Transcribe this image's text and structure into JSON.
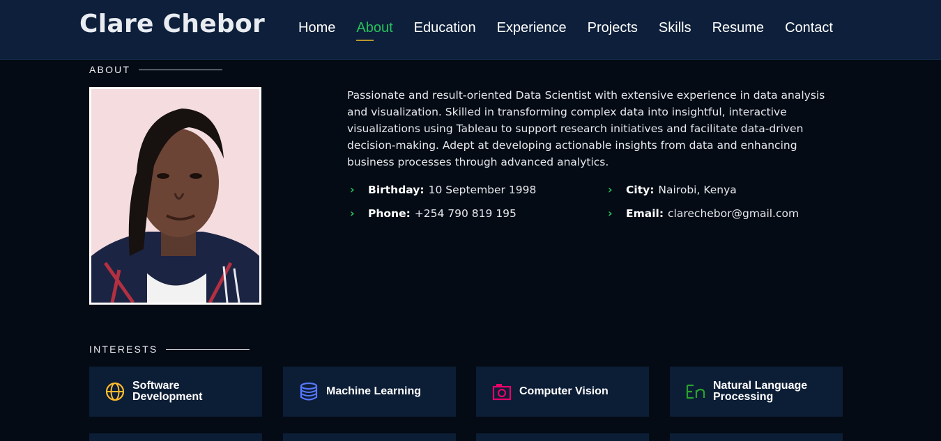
{
  "header": {
    "logo": "Clare Chebor",
    "nav": [
      {
        "label": "Home",
        "active": false
      },
      {
        "label": "About",
        "active": true
      },
      {
        "label": "Education",
        "active": false
      },
      {
        "label": "Experience",
        "active": false
      },
      {
        "label": "Projects",
        "active": false
      },
      {
        "label": "Skills",
        "active": false
      },
      {
        "label": "Resume",
        "active": false
      },
      {
        "label": "Contact",
        "active": false
      }
    ]
  },
  "about": {
    "section_title": "ABOUT",
    "description": "Passionate and result-oriented Data Scientist with extensive experience in data analysis and visualization. Skilled in transforming complex data into insightful, interactive visualizations using Tableau to support research initiatives and facilitate data-driven decision-making. Adept at developing actionable insights from data and enhancing business processes through advanced analytics.",
    "details": {
      "birthday": {
        "label": "Birthday:",
        "value": "10 September 1998"
      },
      "city": {
        "label": "City:",
        "value": "Nairobi, Kenya"
      },
      "phone": {
        "label": "Phone:",
        "value": "+254 790 819 195"
      },
      "email": {
        "label": "Email:",
        "value": "clarechebor@gmail.com"
      }
    }
  },
  "interests": {
    "section_title": "INTERESTS",
    "items": [
      {
        "label": "Software Development",
        "icon": "globe-icon",
        "color": "#ffbb2c"
      },
      {
        "label": "Machine Learning",
        "icon": "database-icon",
        "color": "#5578ff"
      },
      {
        "label": "Computer Vision",
        "icon": "camera-icon",
        "color": "#e80368"
      },
      {
        "label": "Natural Language Processing",
        "icon": "language-icon",
        "color": "#29a329"
      }
    ]
  },
  "colors": {
    "accent": "#27c25c",
    "header_bg": "#0d1f3a",
    "page_bg": "#040b14",
    "card_bg": "#0c1d36"
  }
}
